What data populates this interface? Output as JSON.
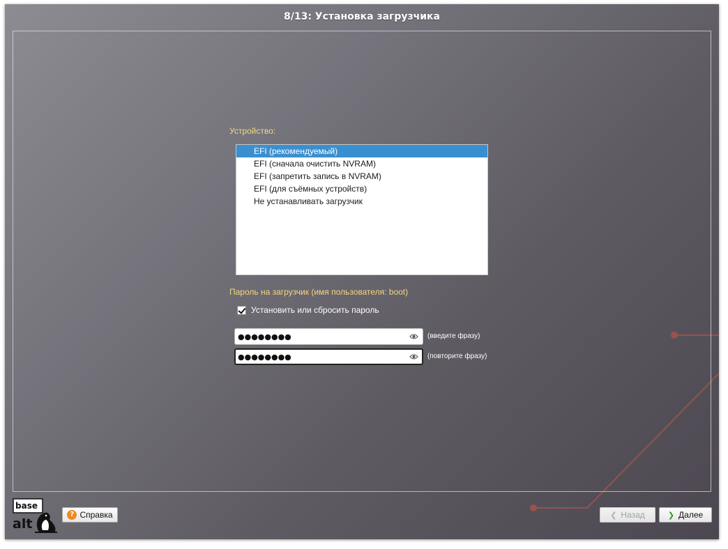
{
  "window": {
    "title": "8/13: Установка загрузчика"
  },
  "device": {
    "label": "Устройство:",
    "items": [
      {
        "label": "EFI (рекомендуемый)",
        "selected": true
      },
      {
        "label": "EFI (сначала очистить NVRAM)",
        "selected": false
      },
      {
        "label": "EFI (запретить запись в NVRAM)",
        "selected": false
      },
      {
        "label": "EFI (для съёмных устройств)",
        "selected": false
      },
      {
        "label": "Не устанавливать загрузчик",
        "selected": false
      }
    ]
  },
  "password": {
    "section_label": "Пароль на загрузчик (имя пользователя: boot)",
    "checkbox_label": "Установить или сбросить пароль",
    "checkbox_checked": true,
    "field1_value": "●●●●●●●●",
    "field1_hint": "(введите фразу)",
    "field2_value": "●●●●●●●●",
    "field2_hint": "(повторите фразу)"
  },
  "logo": {
    "line1": "base",
    "line2": "alt"
  },
  "buttons": {
    "help": "Справка",
    "back": "Назад",
    "next": "Далее"
  },
  "icons": {
    "help": "help-question-icon",
    "eye": "eye-icon",
    "back": "chevron-left-icon",
    "next": "chevron-right-icon",
    "logo": "basealt-penguin-logo"
  },
  "colors": {
    "accent_label": "#f3d782",
    "selection": "#3a8fd0",
    "deco_lines": "#a1524d",
    "help_icon": "#f08a1c",
    "next_chevron": "#2f9a2a"
  }
}
